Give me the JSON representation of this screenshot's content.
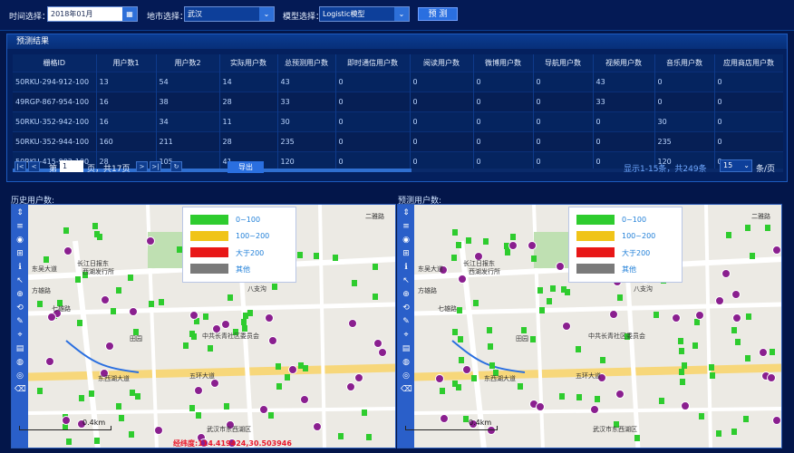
{
  "toolbar": {
    "time_label": "时间选择：",
    "time_value": "2018年01月",
    "city_label": "地市选择：",
    "city_value": "武汉",
    "model_label": "模型选择：",
    "model_value": "Logistic模型",
    "predict_label": "预 测"
  },
  "results": {
    "title": "预测结果",
    "columns": [
      "栅格ID",
      "用户数1",
      "用户数2",
      "实际用户数",
      "总预测用户数",
      "即时通信用户数",
      "阅读用户数",
      "微博用户数",
      "导航用户数",
      "视频用户数",
      "音乐用户数",
      "应用商店用户数"
    ],
    "rows": [
      [
        "50RKU-294-912-100",
        "13",
        "54",
        "14",
        "43",
        "0",
        "0",
        "0",
        "0",
        "43",
        "0",
        "0"
      ],
      [
        "49RGP-867-954-100",
        "16",
        "38",
        "28",
        "33",
        "0",
        "0",
        "0",
        "0",
        "33",
        "0",
        "0"
      ],
      [
        "50RKU-352-942-100",
        "16",
        "34",
        "11",
        "30",
        "0",
        "0",
        "0",
        "0",
        "0",
        "30",
        "0"
      ],
      [
        "50RKU-352-944-100",
        "160",
        "211",
        "28",
        "235",
        "0",
        "0",
        "0",
        "0",
        "0",
        "235",
        "0"
      ],
      [
        "50RKU-415-902-100",
        "28",
        "105",
        "41",
        "120",
        "0",
        "0",
        "0",
        "0",
        "0",
        "120",
        "0"
      ]
    ],
    "pager": {
      "page_prefix": "第",
      "page_value": "1",
      "page_suffix": "页，共17页",
      "export_label": "导出",
      "summary": "显示1-15条，共249条",
      "page_size": "15",
      "page_size_suffix": "条/页"
    }
  },
  "maps": {
    "history_label": "历史用户数:",
    "predict_label": "预测用户数:",
    "legend": [
      {
        "label": "0~100",
        "color": "#2ecc2e"
      },
      {
        "label": "100~200",
        "color": "#f0c419"
      },
      {
        "label": "大于200",
        "color": "#e81717"
      },
      {
        "label": "其他",
        "color": "#7a7a7a"
      }
    ],
    "scale_label": "0.4km",
    "coord_text": "经纬度:114.419424,30.503946",
    "place_labels": [
      "东吴大道",
      "东西湖大道",
      "五环大道",
      "七雄路",
      "田园",
      "长江日报东",
      "西湖发行所",
      "方雄路",
      "八支沟",
      "中共长青社区委员会",
      "武汉市东西湖区",
      "二雅路"
    ]
  }
}
